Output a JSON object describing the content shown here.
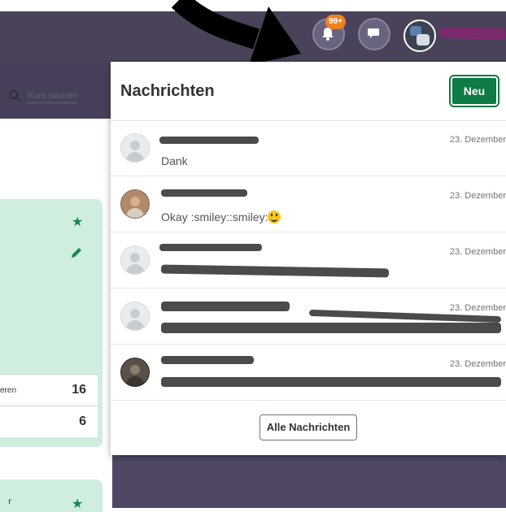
{
  "header": {
    "notifications_badge": "99+",
    "icons": [
      "bell-icon",
      "chat-bubble-icon"
    ]
  },
  "sidebar": {
    "search_label": "Kurs suchen",
    "rows": [
      {
        "label": "eren",
        "count": "16"
      },
      {
        "label": "",
        "count": "6"
      }
    ]
  },
  "messages_dropdown": {
    "title": "Nachrichten",
    "new_button": "Neu",
    "all_button": "Alle Nachrichten",
    "items": [
      {
        "date": "23. Dezember",
        "text": "Dank",
        "avatar": "placeholder"
      },
      {
        "date": "23. Dezember",
        "text": "Okay :smiley::smiley:",
        "emoji": true,
        "avatar": "photo"
      },
      {
        "date": "23. Dezember",
        "text": "",
        "avatar": "placeholder"
      },
      {
        "date": "23. Dezember",
        "text": "",
        "avatar": "placeholder"
      },
      {
        "date": "23. Dezember",
        "text": "",
        "avatar": "dark"
      }
    ]
  },
  "colors": {
    "brand_green": "#0e7a44",
    "badge_orange": "#f0821e",
    "topbar": "#4a4259",
    "card_green": "#cfeede"
  }
}
